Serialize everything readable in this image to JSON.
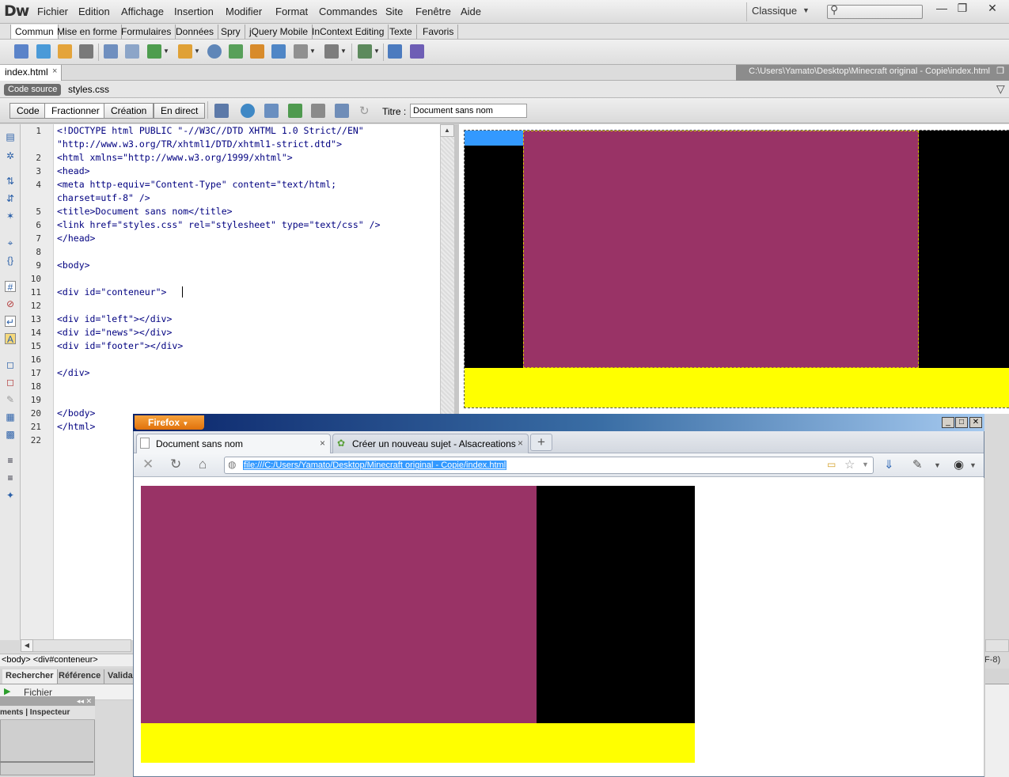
{
  "app": {
    "logo": "Dw",
    "menu": [
      "Fichier",
      "Edition",
      "Affichage",
      "Insertion",
      "Modifier",
      "Format",
      "Commandes",
      "Site",
      "Fenêtre",
      "Aide"
    ],
    "workspace": "Classique",
    "window_buttons": [
      "—",
      "❐",
      "✕"
    ]
  },
  "insert_tabs": [
    "Commun",
    "Mise en forme",
    "Formulaires",
    "Données",
    "Spry",
    "jQuery Mobile",
    "InContext Editing",
    "Texte",
    "Favoris"
  ],
  "document": {
    "tab_name": "index.html",
    "tab_close": "×",
    "path": "C:\\Users\\Yamato\\Desktop\\Minecraft original - Copie\\index.html",
    "related": {
      "code_source": "Code source",
      "styles": "styles.css"
    }
  },
  "doc_toolbar": {
    "views": [
      "Code",
      "Fractionner",
      "Création",
      "En direct"
    ],
    "active_view": "Fractionner",
    "title_label": "Titre :",
    "title_value": "Document sans nom"
  },
  "code": {
    "line_numbers": [
      "1",
      "",
      "2",
      "3",
      "4",
      "",
      "5",
      "6",
      "7",
      "8",
      "9",
      "10",
      "11",
      "12",
      "13",
      "14",
      "15",
      "16",
      "17",
      "18",
      "19",
      "20",
      "21",
      "22"
    ],
    "lines": [
      "<!DOCTYPE html PUBLIC \"-//W3C//DTD XHTML 1.0 Strict//EN\"",
      "\"http://www.w3.org/TR/xhtml1/DTD/xhtml1-strict.dtd\">",
      "<html xmlns=\"http://www.w3.org/1999/xhtml\">",
      "<head>",
      "<meta http-equiv=\"Content-Type\" content=\"text/html;",
      "charset=utf-8\" />",
      "<title>Document sans nom</title>",
      "<link href=\"styles.css\" rel=\"stylesheet\" type=\"text/css\" />",
      "</head>",
      "",
      "<body>",
      "",
      "<div id=\"conteneur\">",
      "",
      "<div id=\"left\"></div>",
      "<div id=\"news\"></div>",
      "<div id=\"footer\"></div>",
      "",
      "</div>",
      "",
      "",
      "</body>",
      "</html>",
      ""
    ]
  },
  "design_colors": {
    "blue": "#3399ff",
    "news": "#993366",
    "black": "#000000",
    "footer": "#ffff00"
  },
  "bottom_panels": {
    "tag_selector": "<body> <div#conteneur>",
    "results_tabs": [
      "Rechercher",
      "Référence",
      "Valida"
    ],
    "fichier": "Fichier",
    "panel_tabs": "ments | Inspecteur",
    "encoding_fragment": "F-8)"
  },
  "firefox": {
    "menu_button": "Firefox",
    "tabs": [
      {
        "title": "Document sans nom",
        "close": "×"
      },
      {
        "title": "Créer un nouveau sujet - Alsacreations",
        "close": "×"
      }
    ],
    "new_tab": "+",
    "url": "file:///C:/Users/Yamato/Desktop/Minecraft original - Copie/index.html",
    "window_buttons": [
      "_",
      "□",
      "✕"
    ]
  }
}
